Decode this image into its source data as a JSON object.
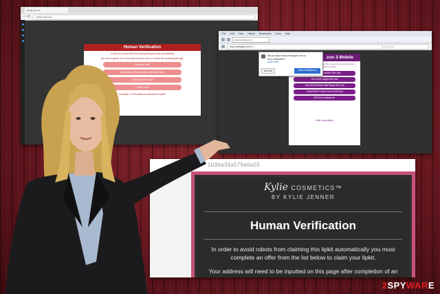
{
  "window1": {
    "tab_title": "ambig.sec.com",
    "nav": "‹  ›  ⟳",
    "url": "iss9d.host.com",
    "modal": {
      "title": "Human Verification",
      "text1": "In order to prevent bots from viewing this give-away automatically",
      "text2": "you must complete one of the offers below in order to receive the requested gift page.",
      "buttons": [
        "Promotion offer",
        "Watch trailer (Fortnite/minecraft/other) about",
        "Gaia wins/Online $50",
        "1 Offer Online"
      ],
      "footer": "Complete 1 of the offers to unlock the content"
    }
  },
  "window2": {
    "menu": [
      "File",
      "Edit",
      "View",
      "History",
      "Bookmarks",
      "Tools",
      "Help"
    ],
    "tab_title": "www.sa.mplea.com",
    "url": "www.xsdfghjkl.com/?=...",
    "search_placeholder": "Search",
    "notification": {
      "line1": "Will you allow www.verificayjobs.com to",
      "line2": "send notifications?",
      "link": "Learn more",
      "not_now": "Not Now",
      "allow": "Allow Notifications"
    },
    "offer": {
      "title": "zon 3 Mobile",
      "text": "Please complete an offer to unlock the content from the list below in order to unlock the mobile.",
      "buttons": [
        "Get a $100 McDonald's Gift Card",
        "Get a $100 Target Gift Card",
        "Claim $100 Buffalo Wild Wings Gift Card",
        "Collect $100 Costco Groom Gift Card",
        "$1000 for walmartcon"
      ],
      "footer": "Offer Incompleted"
    }
  },
  "window3": {
    "url_fragment": "1b3ba34a578a6a55",
    "logo_script": "Kylie",
    "logo_word": "COSMETICS",
    "logo_tm": "™",
    "logo_sub": "BY KYLIE JENNER",
    "title": "Human Verification",
    "para1": "In order to avoid robots from claiming this lipkit automatically you must complete an offer from the list below to claim your lipkit.",
    "para2": "Your address will need to be inputted on this page after completion of an offer below..."
  },
  "watermark": {
    "n2": "2",
    "sp": "SPY",
    "wa": "WAR",
    "e": "E"
  },
  "colors": {
    "background": "#6a1820",
    "modal_red": "#b02020",
    "modal_button": "#ef8e8e",
    "offer_purple": "#6b1a76",
    "kylie_border": "#c7527a",
    "watermark_red": "#e02020"
  }
}
